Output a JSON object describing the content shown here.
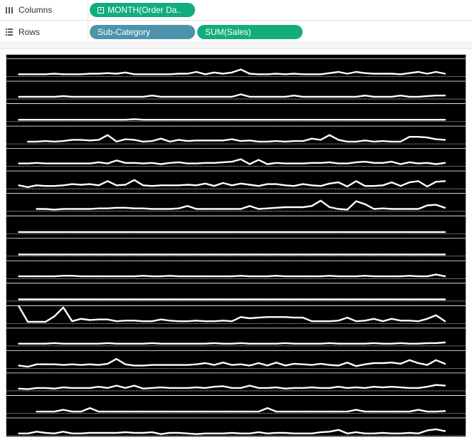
{
  "shelves": {
    "columns": {
      "label": "Columns",
      "icon": "columns-icon",
      "pills": [
        {
          "text": "MONTH(Order Da..",
          "type": "date",
          "color": "#13ad7d"
        }
      ]
    },
    "rows": {
      "label": "Rows",
      "icon": "rows-icon",
      "pills": [
        {
          "text": "Sub-Category",
          "type": "dimension",
          "color": "#4e93ae"
        },
        {
          "text": "SUM(Sales)",
          "type": "measure",
          "color": "#13ad7d"
        }
      ]
    }
  },
  "colors": {
    "background": "#000000",
    "line": "#ffffff",
    "gridline": "#ffffff"
  },
  "chart_data": {
    "type": "line",
    "title": "",
    "xlabel": "",
    "ylabel": "",
    "x_field": "MONTH(Order Date)",
    "y_field": "SUM(Sales)",
    "row_field": "Sub-Category",
    "points_per_series": 48,
    "grid": "dotted baseline per row",
    "series": [
      {
        "values": [
          2,
          2,
          2,
          2,
          3,
          2,
          2,
          2,
          3,
          3,
          4,
          3,
          5,
          2,
          2,
          2,
          2,
          2,
          3,
          3,
          6,
          2,
          5,
          3,
          5,
          10,
          3,
          2,
          2,
          3,
          2,
          3,
          2,
          2,
          2,
          4,
          6,
          3,
          6,
          4,
          3,
          3,
          3,
          2,
          4,
          6,
          3,
          6,
          3
        ]
      },
      {
        "values": [
          2,
          2,
          2,
          2,
          2,
          3,
          2,
          2,
          2,
          2,
          2,
          2,
          2,
          2,
          2,
          4,
          2,
          2,
          2,
          2,
          2,
          2,
          2,
          2,
          2,
          6,
          2,
          2,
          2,
          2,
          2,
          4,
          2,
          2,
          2,
          2,
          2,
          2,
          2,
          4,
          2,
          2,
          2,
          4,
          2,
          2,
          3,
          4,
          4
        ]
      },
      {
        "values": [
          1,
          1,
          1,
          1,
          1,
          1,
          1,
          1,
          1,
          1,
          1,
          1,
          1,
          2,
          1,
          1,
          1,
          1,
          1,
          1,
          1,
          1,
          1,
          1,
          1,
          1,
          1,
          1,
          1,
          1,
          1,
          1,
          1,
          1,
          1,
          1,
          1,
          1,
          1,
          1,
          1,
          1,
          1,
          1,
          1,
          1,
          1,
          1,
          1
        ]
      },
      {
        "values": [
          2,
          2,
          3,
          2,
          3,
          5,
          5,
          4,
          5,
          13,
          2,
          6,
          5,
          2,
          3,
          7,
          2,
          5,
          3,
          4,
          4,
          4,
          4,
          6,
          3,
          4,
          2,
          2,
          3,
          2,
          3,
          3,
          7,
          5,
          13,
          5,
          2,
          2,
          4,
          2,
          3,
          2,
          2,
          10,
          10,
          9,
          6,
          5
        ]
      },
      {
        "values": [
          3,
          3,
          4,
          3,
          3,
          3,
          3,
          3,
          3,
          5,
          3,
          8,
          4,
          4,
          3,
          4,
          2,
          4,
          5,
          3,
          3,
          4,
          4,
          5,
          6,
          10,
          2,
          9,
          2,
          4,
          3,
          3,
          3,
          4,
          4,
          5,
          3,
          3,
          5,
          6,
          4,
          4,
          6,
          2,
          5,
          3,
          4,
          2,
          4
        ]
      },
      {
        "values": [
          4,
          1,
          4,
          3,
          3,
          4,
          6,
          5,
          6,
          4,
          11,
          4,
          5,
          13,
          4,
          3,
          4,
          4,
          4,
          5,
          4,
          7,
          3,
          8,
          4,
          7,
          5,
          3,
          6,
          6,
          4,
          3,
          6,
          4,
          3,
          7,
          9,
          2,
          11,
          3,
          3,
          4,
          9,
          3,
          9,
          11,
          2,
          10,
          11
        ]
      },
      {
        "values": [
          2,
          2,
          1,
          2,
          2,
          2,
          2,
          3,
          3,
          4,
          4,
          3,
          3,
          2,
          2,
          2,
          3,
          7,
          2,
          2,
          2,
          2,
          2,
          2,
          7,
          2,
          3,
          4,
          5,
          5,
          5,
          7,
          16,
          5,
          2,
          1,
          15,
          10,
          2,
          3,
          2,
          2,
          2,
          2,
          8,
          9,
          4
        ]
      },
      {
        "values": [
          1,
          1,
          1,
          1,
          1,
          1,
          1,
          1,
          1,
          1,
          1,
          1,
          1,
          1,
          1,
          1,
          1,
          1,
          1,
          1,
          1,
          1,
          1,
          1,
          1,
          1,
          1,
          1,
          1,
          1,
          1,
          1,
          1,
          1,
          1,
          1,
          1,
          1,
          1,
          1,
          1,
          1,
          1,
          1,
          1,
          1,
          1,
          1,
          1
        ]
      },
      {
        "values": [
          1,
          1,
          1,
          1,
          1,
          1,
          1,
          1,
          1,
          1,
          1,
          1,
          1,
          1,
          1,
          1,
          1,
          1,
          1,
          1,
          1,
          1,
          1,
          1,
          1,
          1,
          1,
          1,
          1,
          1,
          1,
          1,
          1,
          1,
          1,
          1,
          1,
          1,
          1,
          1,
          1,
          1,
          1,
          1,
          1,
          1,
          1,
          1,
          1
        ]
      },
      {
        "values": [
          2,
          2,
          2,
          2,
          2,
          3,
          3,
          2,
          2,
          2,
          2,
          2,
          2,
          2,
          3,
          2,
          2,
          3,
          2,
          2,
          2,
          2,
          2,
          2,
          2,
          3,
          2,
          2,
          2,
          3,
          2,
          2,
          2,
          2,
          2,
          3,
          2,
          2,
          2,
          3,
          2,
          2,
          2,
          2,
          3,
          2,
          2,
          5,
          2
        ]
      },
      {
        "values": [
          1,
          1,
          1,
          1,
          1,
          1,
          1,
          1,
          1,
          1,
          1,
          1,
          1,
          1,
          1,
          1,
          1,
          1,
          1,
          1,
          1,
          1,
          1,
          1,
          1,
          1,
          1,
          1,
          1,
          1,
          1,
          1,
          1,
          1,
          1,
          1,
          1,
          1,
          1,
          1,
          1,
          1,
          1,
          1,
          1,
          1,
          1,
          1,
          1
        ]
      },
      {
        "values": [
          27,
          1,
          1,
          1,
          10,
          25,
          2,
          6,
          4,
          5,
          5,
          2,
          3,
          3,
          2,
          2,
          5,
          3,
          2,
          2,
          3,
          2,
          2,
          3,
          2,
          9,
          7,
          8,
          9,
          9,
          9,
          8,
          8,
          2,
          2,
          2,
          3,
          8,
          2,
          3,
          6,
          2,
          6,
          3,
          3,
          2,
          6,
          12,
          2
        ]
      },
      {
        "values": [
          2,
          2,
          2,
          2,
          3,
          2,
          2,
          2,
          2,
          2,
          3,
          2,
          2,
          2,
          2,
          3,
          2,
          2,
          2,
          2,
          2,
          2,
          3,
          2,
          2,
          3,
          2,
          2,
          2,
          2,
          3,
          2,
          2,
          2,
          2,
          3,
          2,
          2,
          2,
          2,
          3,
          2,
          2,
          3,
          2,
          2,
          3,
          3,
          4
        ]
      },
      {
        "values": [
          3,
          1,
          5,
          5,
          5,
          4,
          5,
          4,
          5,
          4,
          6,
          14,
          5,
          3,
          3,
          4,
          4,
          4,
          4,
          4,
          5,
          7,
          4,
          8,
          4,
          5,
          3,
          7,
          3,
          8,
          3,
          6,
          5,
          4,
          6,
          4,
          3,
          8,
          2,
          5,
          7,
          7,
          8,
          6,
          12,
          7,
          4,
          12,
          6
        ]
      },
      {
        "values": [
          2,
          1,
          3,
          3,
          2,
          4,
          3,
          3,
          3,
          5,
          3,
          7,
          3,
          7,
          2,
          3,
          4,
          3,
          3,
          3,
          4,
          3,
          5,
          6,
          3,
          3,
          7,
          3,
          3,
          4,
          2,
          3,
          3,
          4,
          3,
          3,
          5,
          3,
          4,
          3,
          5,
          4,
          5,
          4,
          3,
          3,
          5,
          8,
          7
        ]
      },
      {
        "values": [
          1,
          1,
          1,
          4,
          1,
          1,
          7,
          1,
          1,
          1,
          1,
          1,
          1,
          1,
          1,
          1,
          1,
          1,
          1,
          1,
          1,
          1,
          1,
          1,
          1,
          1,
          7,
          1,
          1,
          1,
          1,
          1,
          1,
          1,
          1,
          1,
          4,
          1,
          1,
          1,
          1,
          1,
          1,
          4,
          1,
          1,
          2
        ]
      },
      {
        "values": [
          2,
          2,
          5,
          3,
          2,
          5,
          2,
          2,
          3,
          3,
          3,
          3,
          4,
          3,
          3,
          4,
          1,
          3,
          3,
          2,
          1,
          2,
          2,
          2,
          3,
          2,
          2,
          4,
          2,
          3,
          3,
          2,
          2,
          2,
          4,
          5,
          8,
          2,
          4,
          2,
          2,
          3,
          2,
          2,
          3,
          2,
          7,
          9,
          6
        ]
      }
    ]
  }
}
